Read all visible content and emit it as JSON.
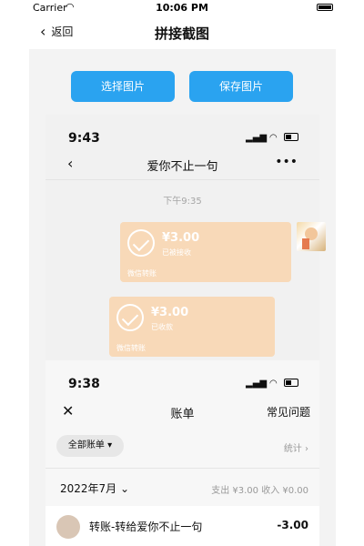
{
  "status_bar": {
    "carrier": "Carrier",
    "time": "10:06 PM"
  },
  "nav": {
    "back_label": "返回",
    "title": "拼接截图"
  },
  "actions": {
    "select_label": "选择图片",
    "save_label": "保存图片"
  },
  "screenshot1": {
    "time": "9:43",
    "chat_title": "爱你不止一句",
    "more": "•••",
    "timestamp": "下午9:35",
    "transfers": [
      {
        "amount": "¥3.00",
        "status": "已被接收",
        "footer": "微信转账"
      },
      {
        "amount": "¥3.00",
        "status": "已收款",
        "footer": "微信转账"
      }
    ]
  },
  "screenshot2": {
    "time": "9:38",
    "title": "账单",
    "faq": "常见问题",
    "filter": "全部账单 ▾",
    "stats": "统计 ›",
    "month": "2022年7月 ⌄",
    "summary": "支出 ¥3.00  收入 ¥0.00",
    "row": {
      "text": "转账-转给爱你不止一句",
      "amount": "-3.00"
    }
  }
}
